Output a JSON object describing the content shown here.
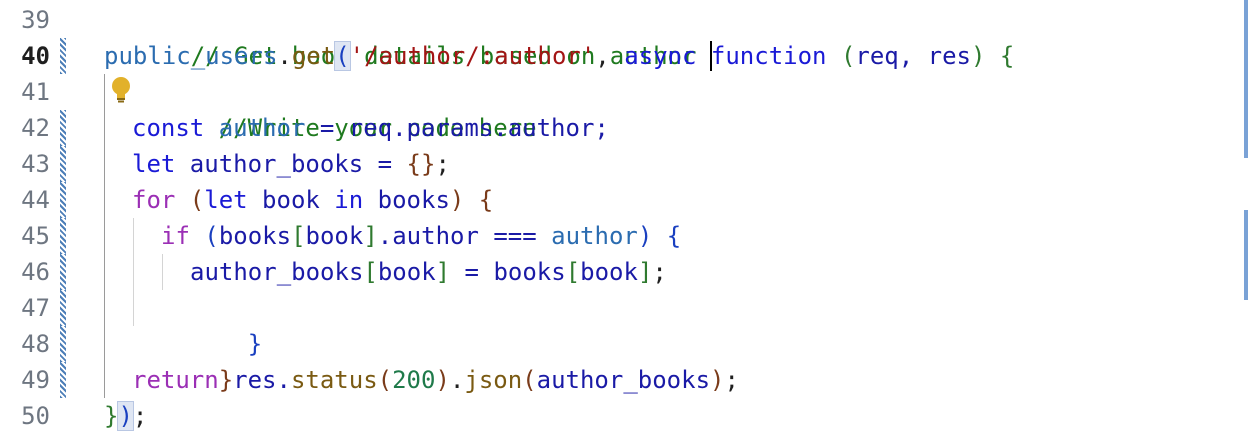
{
  "editor": {
    "line_numbers": [
      "39",
      "40",
      "41",
      "42",
      "43",
      "44",
      "45",
      "46",
      "47",
      "48",
      "49",
      "50"
    ],
    "active_line": "40"
  },
  "code": {
    "l39": "// Get book details based on author",
    "l40": {
      "obj": "public_users",
      "dot": ".",
      "method": "get",
      "open": "(",
      "path": "'/author/:author'",
      "comma": ", ",
      "async": "async ",
      "function": "function",
      "space": " ",
      "popen": "(",
      "params": "req, res",
      "pclose": ")",
      "brace": " {"
    },
    "l41": "//Write your code here",
    "l42": {
      "kw": "const ",
      "name": "author",
      "rest": " = req.params.author;"
    },
    "l43": {
      "kw": "let ",
      "rest": "author_books = ",
      "braces": "{}",
      "semi": ";"
    },
    "l44": {
      "kw": "for ",
      "open": "(",
      "kw2": "let ",
      "a": "book ",
      "kw3": "in ",
      "b": "books",
      "close": ")",
      "brace": " {"
    },
    "l45": {
      "kw": "if ",
      "open": "(",
      "a": "books",
      "ob": "[",
      "b": "book",
      "cb": "]",
      "c": ".author === ",
      "name": "author",
      "close": ")",
      "brace": " {"
    },
    "l46": {
      "a": "author_books",
      "ob": "[",
      "b": "book",
      "cb": "]",
      "c": " = books",
      "ob2": "[",
      "d": "book",
      "cb2": "]",
      "semi": ";"
    },
    "l47": "}",
    "l48": "}",
    "l49": {
      "kw": "return ",
      "a": "res.",
      "fn1": "status",
      "open": "(",
      "num": "200",
      "close": ")",
      "dot": ".",
      "fn2": "json",
      "open2": "(",
      "b": "author_books",
      "close2": ")",
      "semi": ";"
    },
    "l50": {
      "brace": "}",
      "paren": ")",
      "semi": ";"
    }
  },
  "colors": {
    "comment": "#1f7a1f",
    "keyword": "#1a1ad6",
    "control": "#9b2fb5",
    "string": "#a31515",
    "function": "#7a5a12",
    "number": "#1f7a4a",
    "diff_marker": "#4d7fb8"
  },
  "icons": {
    "lightbulb": "lightbulb-icon"
  }
}
